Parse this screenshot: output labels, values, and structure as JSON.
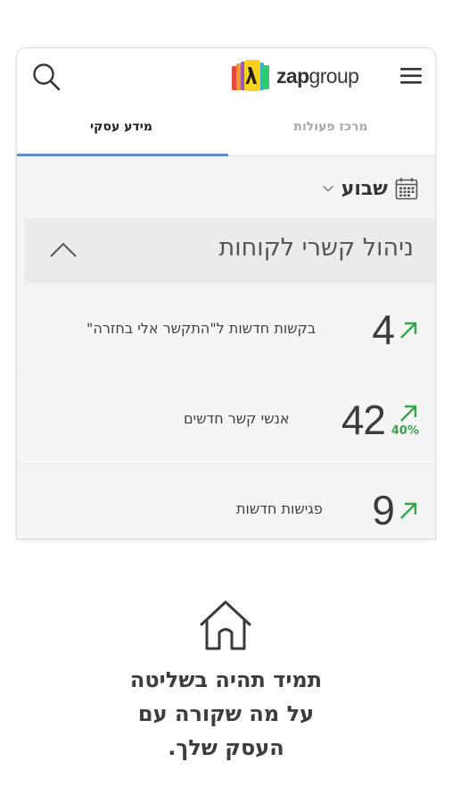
{
  "header": {
    "brand_word_bold": "zap",
    "brand_word": "group",
    "icons": [
      "search-icon",
      "hamburger-menu-icon",
      "zapgroup-logo"
    ]
  },
  "tabs": [
    {
      "label": "מידע עסקי",
      "active": true
    },
    {
      "label": "מרכז פעולות",
      "active": false
    }
  ],
  "period": {
    "label": "שבוע",
    "icon": "calendar-icon"
  },
  "section": {
    "title": "ניהול קשרי לקוחות",
    "expanded": true
  },
  "metrics": [
    {
      "value": "4",
      "label": "בקשות חדשות ל\"התקשר אלי בחזרה\"",
      "trend": "up",
      "change": ""
    },
    {
      "value": "42",
      "label": "אנשי קשר חדשים",
      "trend": "up",
      "change": "40%"
    },
    {
      "value": "9",
      "label": "פגישות חדשות",
      "trend": "up",
      "change": ""
    }
  ],
  "tagline": {
    "line1": "תמיד תהיה בשליטה",
    "line2": "על מה שקורה עם",
    "line3": "העסק שלך."
  },
  "colors": {
    "accent_tab": "#5a8fd1",
    "trend_up": "#37a34a",
    "text": "#3c3c3c"
  }
}
